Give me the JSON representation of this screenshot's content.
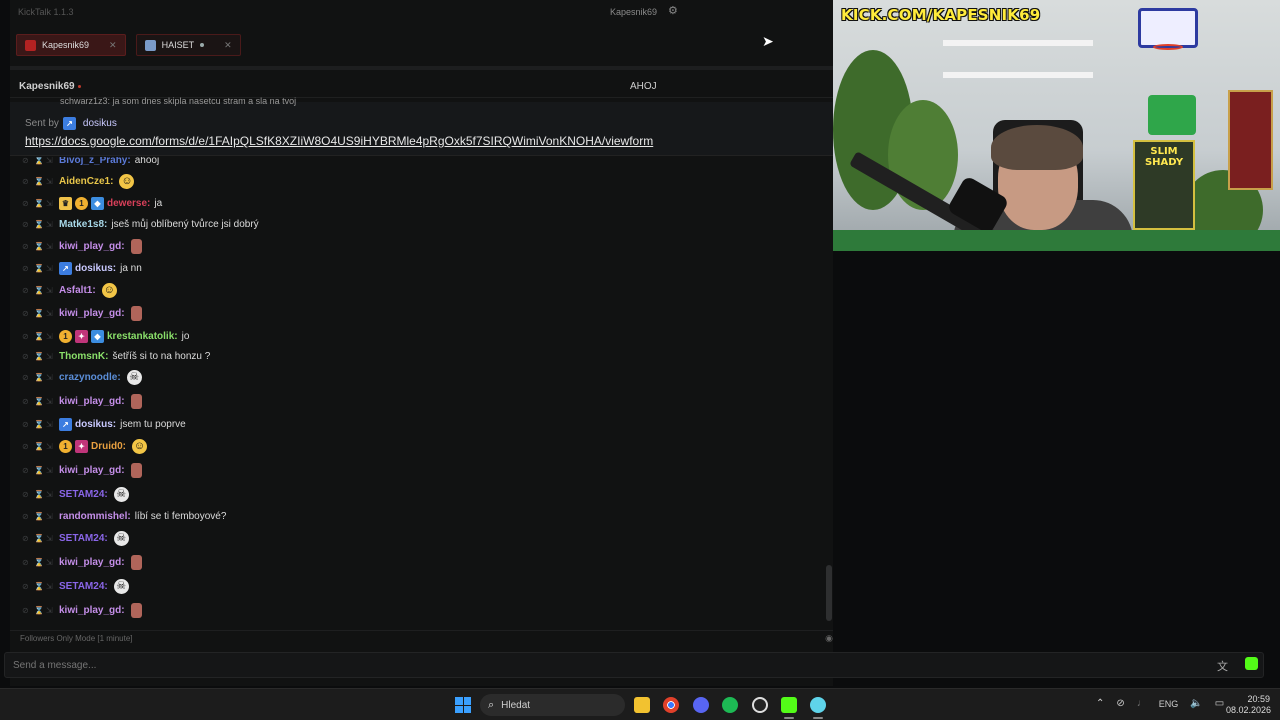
{
  "app": {
    "version": "KickTalk 1.1.3",
    "title_user": "Kapesnik69"
  },
  "tabs": [
    {
      "label": "Kapesnik69",
      "active": true
    },
    {
      "label": "HAISET",
      "active": false
    }
  ],
  "channel": {
    "name": "Kapesnik69",
    "title": "AHOJ"
  },
  "pinned": {
    "cut_line": "schwarz1z3: ja som dnes skipla nasetcu stram a sla na tvoj",
    "sent_by_label": "Sent by",
    "sent_by_user": "dosikus",
    "link": "https://docs.google.com/forms/d/e/1FAIpQLSfK8XZIiW8O4US9iHYBRMle4pRgOxk5f7SIRQWimiVonKNOHA/viewform"
  },
  "messages": [
    {
      "user": "Bivoj_z_Prahy:",
      "color": "#5b7ad8",
      "text": "ahooj",
      "badges": [],
      "emote": ""
    },
    {
      "user": "AidenCze1:",
      "color": "#e8c64a",
      "text": "",
      "badges": [],
      "emote": "lol"
    },
    {
      "user": "dewerse:",
      "color": "#d9405a",
      "text": "ja",
      "badges": [
        "crown",
        "sub",
        "blue"
      ],
      "emote": ""
    },
    {
      "user": "Matke1s8:",
      "color": "#a8d8e8",
      "text": "jseš můj oblíbený tvůrce jsi dobrý",
      "badges": [],
      "emote": ""
    },
    {
      "user": "kiwi_play_gd:",
      "color": "#c48ee8",
      "text": "",
      "badges": [],
      "emote": "face"
    },
    {
      "user": "dosikus:",
      "color": "#c9c9ff",
      "text": "ja nn",
      "badges": [
        "verified"
      ],
      "emote": ""
    },
    {
      "user": "Asfalt1:",
      "color": "#c48ee8",
      "text": "",
      "badges": [],
      "emote": "lol"
    },
    {
      "user": "kiwi_play_gd:",
      "color": "#c48ee8",
      "text": "",
      "badges": [],
      "emote": "face"
    },
    {
      "user": "krestankatolik:",
      "color": "#8ae06a",
      "text": "jo",
      "badges": [
        "sub",
        "pink",
        "blue"
      ],
      "emote": ""
    },
    {
      "user": "ThomsnK:",
      "color": "#8ae06a",
      "text": "šetříš si to na honzu ?",
      "badges": [],
      "emote": ""
    },
    {
      "user": "crazynoodle:",
      "color": "#5b8ed8",
      "text": "",
      "badges": [],
      "emote": "skull"
    },
    {
      "user": "kiwi_play_gd:",
      "color": "#c48ee8",
      "text": "",
      "badges": [],
      "emote": "face"
    },
    {
      "user": "dosikus:",
      "color": "#c9c9ff",
      "text": "jsem tu poprve",
      "badges": [
        "verified"
      ],
      "emote": ""
    },
    {
      "user": "Druid0:",
      "color": "#e8a040",
      "text": "",
      "badges": [
        "sub",
        "pink"
      ],
      "emote": "lol"
    },
    {
      "user": "kiwi_play_gd:",
      "color": "#c48ee8",
      "text": "",
      "badges": [],
      "emote": "face"
    },
    {
      "user": "SETAM24:",
      "color": "#8a66e8",
      "text": "",
      "badges": [],
      "emote": "skull"
    },
    {
      "user": "randommishel:",
      "color": "#c48ee8",
      "text": "líbí se ti femboyové?",
      "badges": [],
      "emote": ""
    },
    {
      "user": "SETAM24:",
      "color": "#8a66e8",
      "text": "",
      "badges": [],
      "emote": "skull"
    },
    {
      "user": "kiwi_play_gd:",
      "color": "#c48ee8",
      "text": "",
      "badges": [],
      "emote": "face"
    },
    {
      "user": "SETAM24:",
      "color": "#8a66e8",
      "text": "",
      "badges": [],
      "emote": "skull"
    },
    {
      "user": "kiwi_play_gd:",
      "color": "#c48ee8",
      "text": "",
      "badges": [],
      "emote": "face"
    }
  ],
  "followers_mode": "Followers Only Mode [1 minute]",
  "composer": {
    "placeholder": "Send a message..."
  },
  "stream": {
    "banner": "KICK.COM/KAPESNIK69",
    "poster_text": "SLIM SHADY"
  },
  "taskbar": {
    "search_placeholder": "Hledat",
    "lang": "ENG",
    "time": "20:59",
    "date": "08.02.2026"
  },
  "colors": {
    "accent": "#53fc18",
    "tab_border": "#5b1d1d"
  },
  "icons": [
    "settings-icon",
    "close-icon",
    "search-icon",
    "info-icon",
    "emote-icon",
    "translate-icon"
  ]
}
